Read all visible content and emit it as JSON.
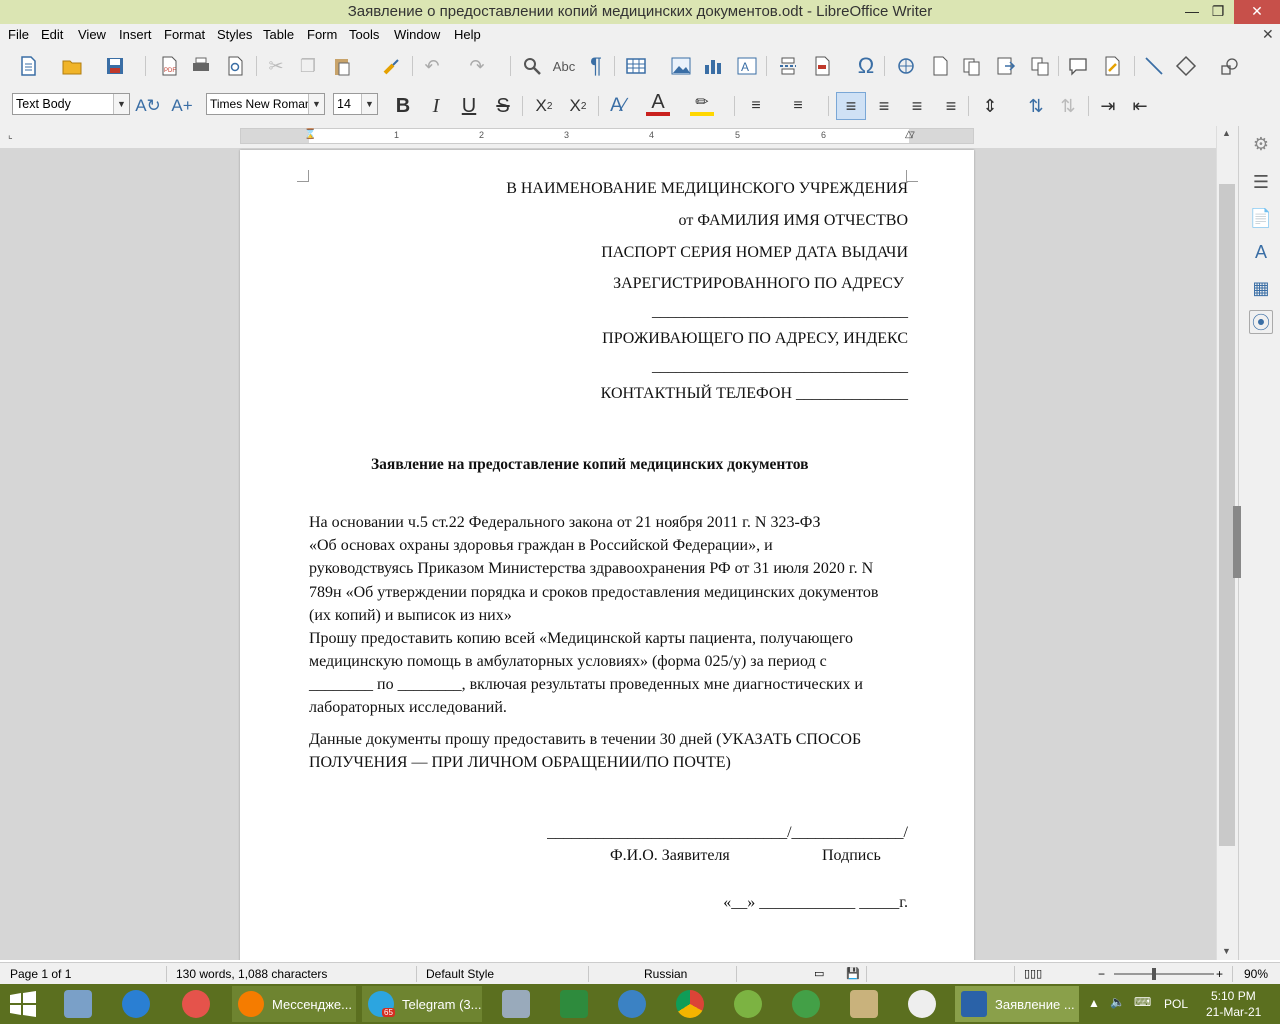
{
  "window": {
    "title": "Заявление о предоставлении копий медицинских документов.odt - LibreOffice Writer"
  },
  "menu": [
    "File",
    "Edit",
    "View",
    "Insert",
    "Format",
    "Styles",
    "Table",
    "Form",
    "Tools",
    "Window",
    "Help"
  ],
  "toolbar": {
    "paragraph_style": "Text Body",
    "font_name": "Times New Roman",
    "font_size": "14"
  },
  "ruler_numbers": [
    "1",
    "2",
    "3",
    "4",
    "5",
    "6",
    "7"
  ],
  "document": {
    "header_lines": [
      "В НАИМЕНОВАНИЕ МЕДИЦИНСКОГО УЧРЕЖДЕНИЯ",
      "от ФАМИЛИЯ ИМЯ ОТЧЕСТВО",
      "ПАСПОРТ СЕРИЯ НОМЕР ДАТА ВЫДАЧИ",
      "ЗАРЕГИСТРИРОВАННОГО ПО АДРЕСУ",
      "________________________________",
      "ПРОЖИВАЮЩЕГО ПО АДРЕСУ, ИНДЕКС",
      "________________________________",
      "КОНТАКТНЫЙ ТЕЛЕФОН ______________"
    ],
    "title": "Заявление на предоставление копий медицинских документов",
    "body_lines": [
      "На основании ч.5 ст.22 Федерального закона от 21 ноября 2011 г. N 323-ФЗ",
      "«Об основах охраны здоровья граждан в Российской Федерации», и",
      "руководствуясь Приказом Министерства здравоохранения РФ от 31 июля 2020 г. N",
      "789н «Об утверждении порядка и сроков предоставления медицинских документов",
      "(их копий) и выписок из них»",
      "Прошу предоставить копию всей «Медицинской карты пациента, получающего",
      "медицинскую помощь в амбулаторных условиях» (форма 025/у) за период с",
      "________ по ________, включая результаты проведенных мне диагностических и",
      "лабораторных исследований.",
      "Данные документы прошу предоставить в течении 30 дней (УКАЗАТЬ СПОСОБ",
      "ПОЛУЧЕНИЯ — ПРИ ЛИЧНОМ ОБРАЩЕНИИ/ПО ПОЧТЕ)"
    ],
    "signature_line": "______________________________/______________/",
    "signature_fio": "Ф.И.О. Заявителя",
    "signature_sign": "Подпись",
    "date_line": "«__» ____________ _____г."
  },
  "status": {
    "page": "Page 1 of 1",
    "words": "130 words, 1,088 characters",
    "style": "Default Style",
    "language": "Russian",
    "zoom": "90%"
  },
  "taskbar": {
    "messenger": "Мессендже...",
    "telegram": "Telegram (3...",
    "telegram_badge": "65",
    "writer": "Заявление ...",
    "lang": "POL",
    "time": "5:10 PM",
    "date": "21-Mar-21"
  }
}
